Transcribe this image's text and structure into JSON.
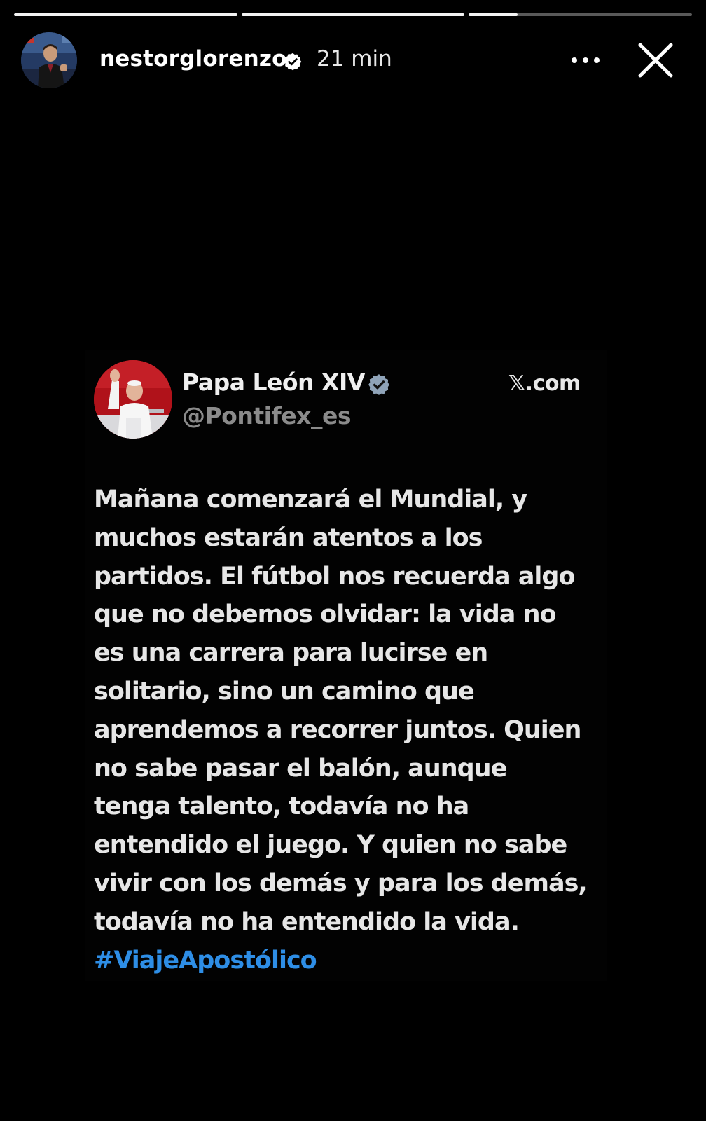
{
  "story": {
    "progress": [
      1.0,
      1.0,
      0.22
    ],
    "user": {
      "username": "nestorglorenzo",
      "verified": true,
      "time_ago": "21 min",
      "avatar_icon": "profile-photo"
    },
    "controls": {
      "more_icon": "more-horizontal-icon",
      "close_icon": "close-icon"
    }
  },
  "tweet": {
    "name": "Papa León XIV",
    "handle": "@Pontifex_es",
    "verified": true,
    "source": "𝕏.com",
    "lines": [
      "Mañana comenzará el Mundial, y",
      "muchos estarán atentos a los",
      "partidos. El fútbol nos recuerda algo",
      "que no debemos olvidar: la vida no",
      "es una carrera para lucirse en",
      "solitario, sino un camino que",
      "aprendemos a recorrer juntos. Quien",
      "no sabe pasar el balón, aunque",
      "tenga talento, todavía no ha",
      "entendido el juego. Y quien no sabe",
      "vivir con los demás y para los demás,",
      "todavía no ha entendido la vida."
    ],
    "hashtag": "#ViajeApostólico",
    "colors": {
      "hashtag": "#2e8ee6",
      "verified_badge": "#8fa3b8",
      "handle": "#8b8b8b"
    }
  }
}
